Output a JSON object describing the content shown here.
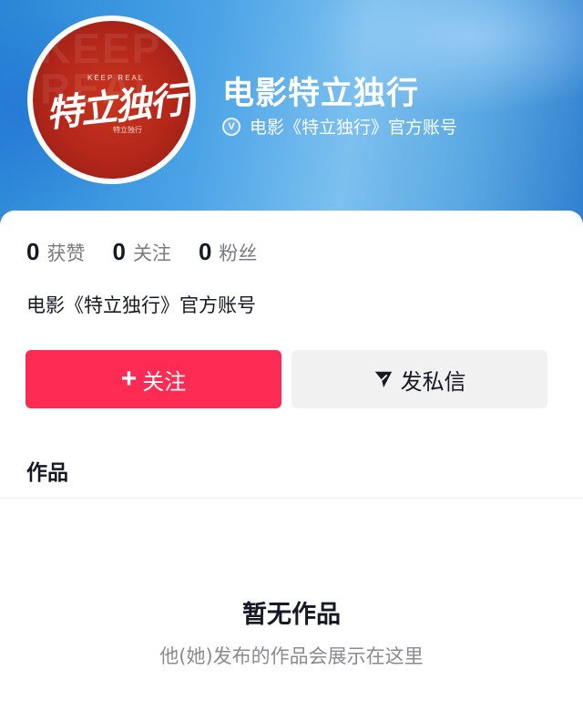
{
  "header": {
    "title": "电影特立独行",
    "verify_badge_letter": "V",
    "verified_text": "电影《特立独行》官方账号",
    "background_color": "#3d94dd"
  },
  "avatar": {
    "logo_text": "特立独行",
    "small_text": "KEEP REAL",
    "watermark_text": "KEEP\nREAL",
    "sub_text": "特立独行",
    "background_color": "#b3271a"
  },
  "stats": [
    {
      "value": "0",
      "label": "获赞"
    },
    {
      "value": "0",
      "label": "关注"
    },
    {
      "value": "0",
      "label": "粉丝"
    }
  ],
  "bio": "电影《特立独行》官方账号",
  "actions": {
    "follow_icon": "+",
    "follow_label": "关注",
    "follow_color": "#fe2c55",
    "message_icon": "send-icon",
    "message_label": "发私信"
  },
  "tabs": {
    "works_label": "作品"
  },
  "empty_state": {
    "title": "暂无作品",
    "description": "他(她)发布的作品会展示在这里"
  }
}
